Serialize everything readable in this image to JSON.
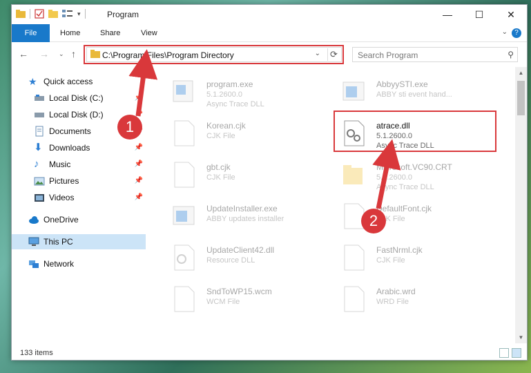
{
  "window": {
    "title": "Program",
    "controls": {
      "minimize": "—",
      "maximize": "☐",
      "close": "✕"
    }
  },
  "ribbon": {
    "file_tab": "File",
    "tabs": [
      "Home",
      "Share",
      "View"
    ],
    "help": "?"
  },
  "address": {
    "path": "C:\\Program Files\\Program Directory",
    "dropdown": "⌄",
    "refresh": "⟳"
  },
  "search": {
    "placeholder": "Search Program"
  },
  "nav": {
    "items": [
      {
        "label": "Quick access"
      },
      {
        "label": "Local Disk (C:)"
      },
      {
        "label": "Local Disk (D:)"
      },
      {
        "label": "Documents"
      },
      {
        "label": "Downloads"
      },
      {
        "label": "Music"
      },
      {
        "label": "Pictures"
      },
      {
        "label": "Videos"
      },
      {
        "label": "OneDrive"
      },
      {
        "label": "This PC"
      },
      {
        "label": "Network"
      }
    ]
  },
  "files": [
    {
      "name": "program.exe",
      "line2": "5.1.2600.0",
      "line3": "Async Trace DLL"
    },
    {
      "name": "AbbyySTI.exe",
      "line2": "ABBY sti event hand...",
      "line3": ""
    },
    {
      "name": "Korean.cjk",
      "line2": "CJK File",
      "line3": ""
    },
    {
      "name": "atrace.dll",
      "line2": "5.1.2600.0",
      "line3": "Async Trace DLL"
    },
    {
      "name": "gbt.cjk",
      "line2": "CJK File",
      "line3": ""
    },
    {
      "name": "Microsoft.VC90.CRT",
      "line2": "5.1.2600.0",
      "line3": "Async Trace DLL"
    },
    {
      "name": "UpdateInstaller.exe",
      "line2": "ABBY updates installer",
      "line3": ""
    },
    {
      "name": "DefaultFont.cjk",
      "line2": "CJK File",
      "line3": ""
    },
    {
      "name": "UpdateClient42.dll",
      "line2": "Resource DLL",
      "line3": ""
    },
    {
      "name": "FastNrml.cjk",
      "line2": "CJK File",
      "line3": ""
    },
    {
      "name": "SndToWP15.wcm",
      "line2": "WCM File",
      "line3": ""
    },
    {
      "name": "Arabic.wrd",
      "line2": "WRD File",
      "line3": ""
    }
  ],
  "status": {
    "count": "133 items"
  },
  "annotations": {
    "step1": "1",
    "step2": "2"
  },
  "colors": {
    "accent": "#1979ca",
    "highlight": "#d9383b",
    "selected": "#cce4f7"
  }
}
